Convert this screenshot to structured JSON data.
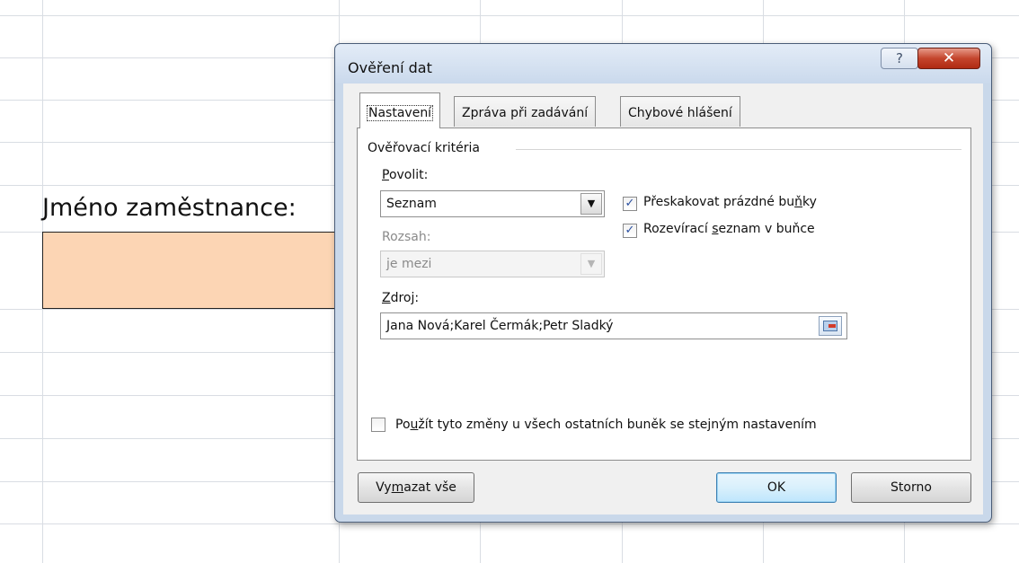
{
  "sheet": {
    "label": "Jméno zaměstnance:",
    "input_cell_color": "#fcd5b4"
  },
  "dialog": {
    "title": "Ověření dat",
    "help_glyph": "?",
    "close_glyph": "✕",
    "tabs": [
      {
        "label": "Nastavení",
        "active": true
      },
      {
        "label": "Zpráva při zadávání",
        "active": false
      },
      {
        "label": "Chybové hlášení",
        "active": false
      }
    ],
    "criteria": {
      "group_title": "Ověřovací kritéria",
      "allow_label_key": "P",
      "allow_label_rest": "ovolit:",
      "allow_value": "Seznam",
      "range_label": "Rozsah:",
      "range_value": "je mezi",
      "ignore_blank": {
        "pre": "Přeskakovat prázdné bu",
        "key": "ň",
        "post": "ky",
        "checked": true
      },
      "in_cell_dropdown": {
        "pre": "Rozevírací ",
        "key": "s",
        "post": "eznam v buňce",
        "checked": true
      },
      "source_label_key": "Z",
      "source_label_rest": "droj:",
      "source_value": "Jana Nová;Karel Čermák;Petr Sladký"
    },
    "apply_all": {
      "pre": "Po",
      "key": "u",
      "post": "žít tyto změny u všech ostatních buněk se stejným nastavením",
      "checked": false
    },
    "buttons": {
      "clear_pre": "Vy",
      "clear_key": "m",
      "clear_post": "azat vše",
      "ok": "OK",
      "cancel": "Storno"
    },
    "colors": {
      "accent": "#3c7fb1",
      "close": "#c4452d",
      "check": "#2a4fa0"
    }
  }
}
